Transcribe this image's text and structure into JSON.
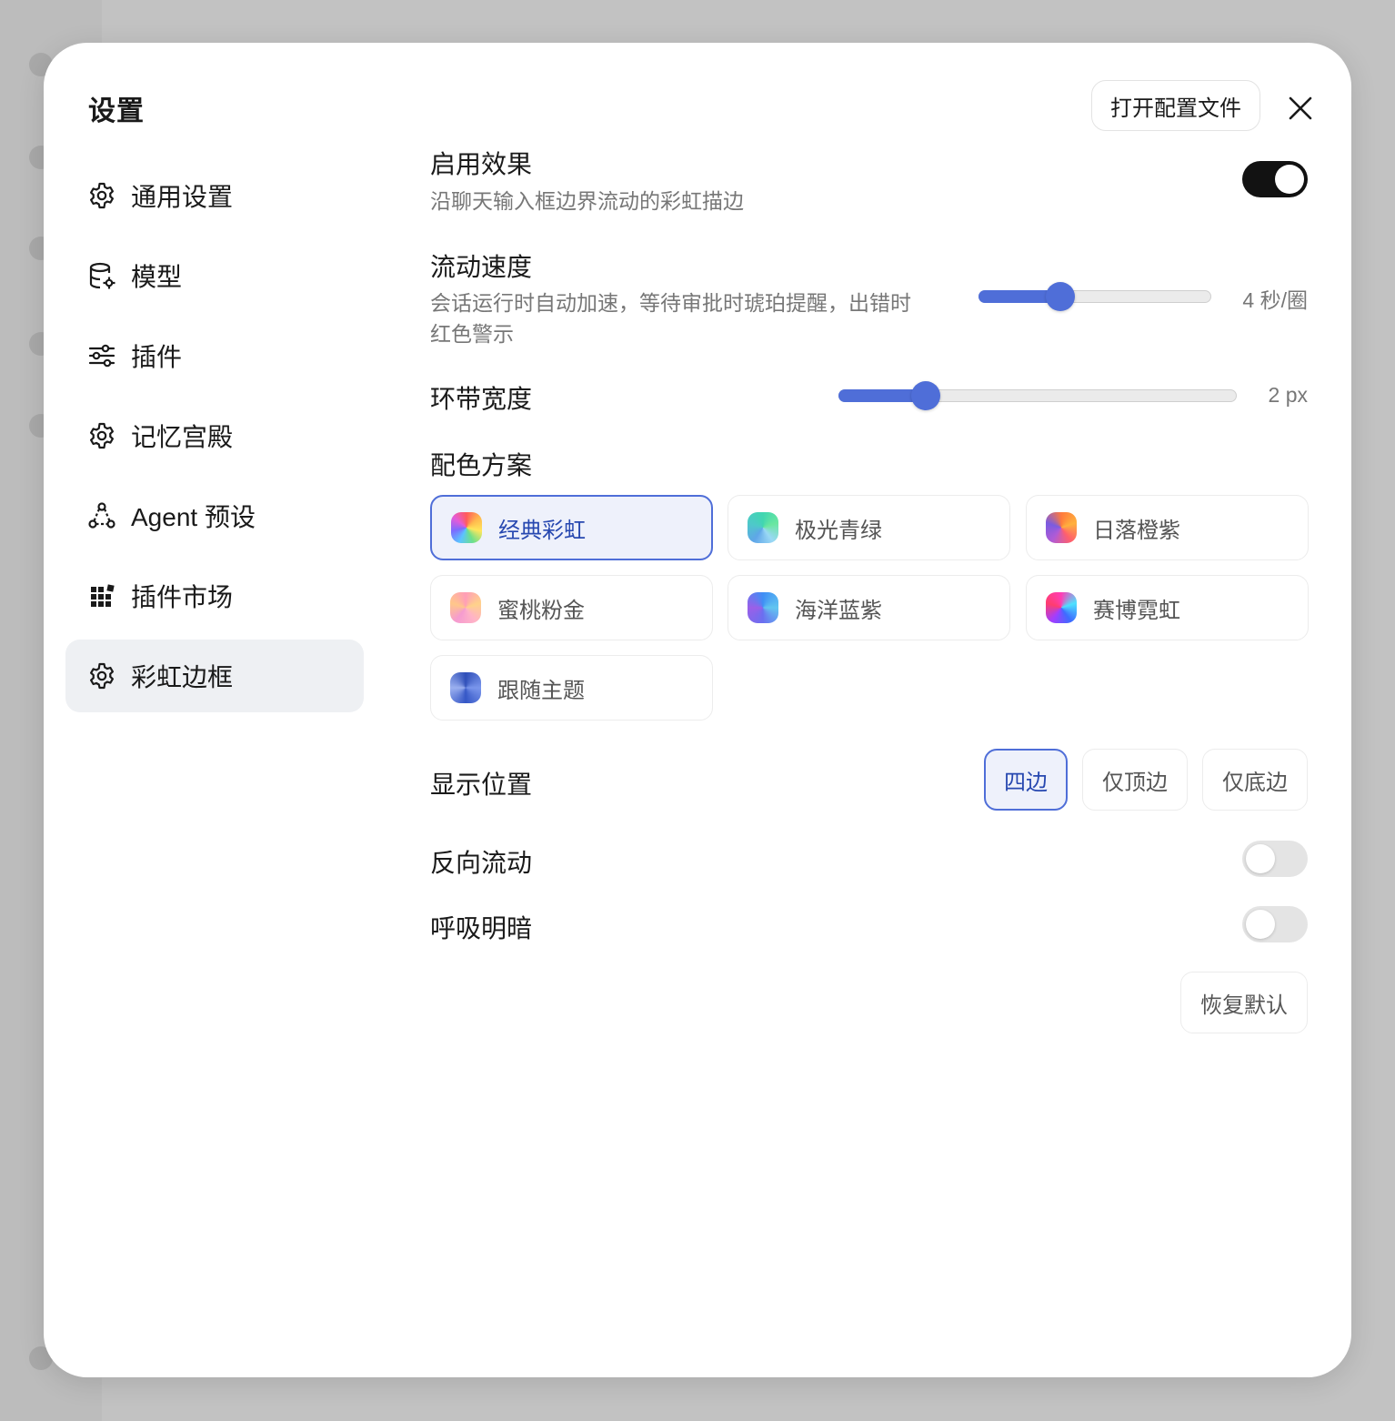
{
  "dialog": {
    "title": "设置",
    "open_config_label": "打开配置文件"
  },
  "sidebar": {
    "items": [
      {
        "label": "通用设置",
        "icon": "gear-icon",
        "active": false
      },
      {
        "label": "模型",
        "icon": "database-icon",
        "active": false
      },
      {
        "label": "插件",
        "icon": "sliders-icon",
        "active": false
      },
      {
        "label": "记忆宫殿",
        "icon": "gear-icon",
        "active": false
      },
      {
        "label": "Agent 预设",
        "icon": "nodes-icon",
        "active": false
      },
      {
        "label": "插件市场",
        "icon": "grid-icon",
        "active": false
      },
      {
        "label": "彩虹边框",
        "icon": "gear-icon",
        "active": true
      }
    ]
  },
  "settings": {
    "enable": {
      "title": "启用效果",
      "desc": "沿聊天输入框边界流动的彩虹描边",
      "on": true
    },
    "speed": {
      "title": "流动速度",
      "desc_line1": "会话运行时自动加速，等待审批时琥珀提醒，出错时",
      "desc_line2": "红色警示",
      "value_label": "4 秒/圈",
      "level": 0.35
    },
    "width": {
      "title": "环带宽度",
      "value_label": "2 px",
      "level": 0.22
    },
    "scheme": {
      "title": "配色方案",
      "options": [
        {
          "label": "经典彩虹",
          "selected": true
        },
        {
          "label": "极光青绿",
          "selected": false
        },
        {
          "label": "日落橙紫",
          "selected": false
        },
        {
          "label": "蜜桃粉金",
          "selected": false
        },
        {
          "label": "海洋蓝紫",
          "selected": false
        },
        {
          "label": "赛博霓虹",
          "selected": false
        },
        {
          "label": "跟随主题",
          "selected": false
        }
      ]
    },
    "position": {
      "title": "显示位置",
      "options": [
        {
          "label": "四边",
          "selected": true
        },
        {
          "label": "仅顶边",
          "selected": false
        },
        {
          "label": "仅底边",
          "selected": false
        }
      ]
    },
    "reverse": {
      "title": "反向流动",
      "on": false
    },
    "breathe": {
      "title": "呼吸明暗",
      "on": false
    },
    "reset_label": "恢复默认"
  },
  "colors": {
    "accent": "#4f6ed8",
    "toggle_on": "#121212",
    "selected_bg": "#eef1fb"
  }
}
